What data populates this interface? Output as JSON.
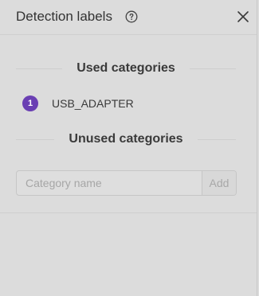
{
  "header": {
    "title": "Detection labels",
    "help_icon": "question-circle-icon",
    "close_icon": "close-icon"
  },
  "used_section": {
    "title": "Used categories",
    "items": [
      {
        "index": "1",
        "name": "USB_ADAPTER",
        "color": "#6a3fb3"
      }
    ]
  },
  "unused_section": {
    "title": "Unused categories"
  },
  "new_category": {
    "placeholder": "Category name",
    "value": "",
    "add_label": "Add"
  },
  "colors": {
    "background": "#dcdcdc",
    "badge": "#6a3fb3"
  }
}
